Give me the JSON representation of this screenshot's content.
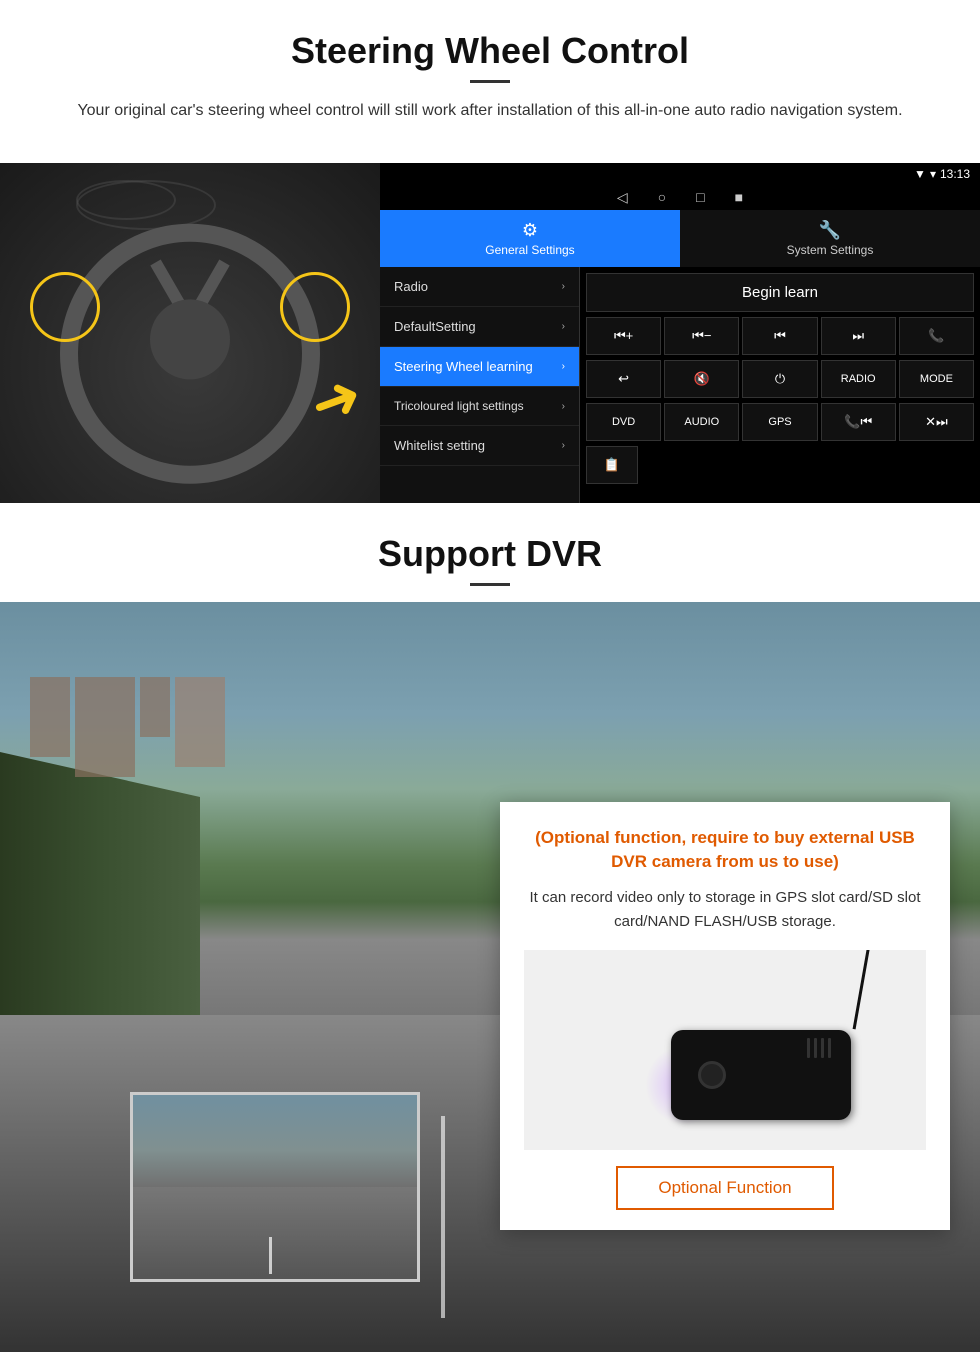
{
  "steering": {
    "title": "Steering Wheel Control",
    "subtitle": "Your original car's steering wheel control will still work after installation of this all-in-one auto radio navigation system.",
    "statusbar": {
      "time": "13:13",
      "signal": "▼",
      "wifi": "▾"
    },
    "nav_icons": [
      "◁",
      "○",
      "□",
      "■"
    ],
    "tabs": [
      {
        "label": "General Settings",
        "icon": "⚙",
        "active": true
      },
      {
        "label": "System Settings",
        "icon": "🔧",
        "active": false
      }
    ],
    "menu_items": [
      {
        "label": "Radio",
        "active": false
      },
      {
        "label": "DefaultSetting",
        "active": false
      },
      {
        "label": "Steering Wheel learning",
        "active": true
      },
      {
        "label": "Tricoloured light settings",
        "active": false
      },
      {
        "label": "Whitelist setting",
        "active": false
      }
    ],
    "begin_learn": "Begin learn",
    "button_rows": [
      [
        "⏮+",
        "⏮-",
        "⏮⏮",
        "⏭⏭",
        "📞"
      ],
      [
        "↩",
        "🔇",
        "⏻",
        "RADIO",
        "MODE"
      ],
      [
        "DVD",
        "AUDIO",
        "GPS",
        "📞⏮",
        "✕⏭"
      ],
      [
        "📋"
      ]
    ]
  },
  "dvr": {
    "title": "Support DVR",
    "info_title": "(Optional function, require to buy external USB DVR camera from us to use)",
    "info_text": "It can record video only to storage in GPS slot card/SD slot card/NAND FLASH/USB storage.",
    "optional_button": "Optional Function"
  }
}
